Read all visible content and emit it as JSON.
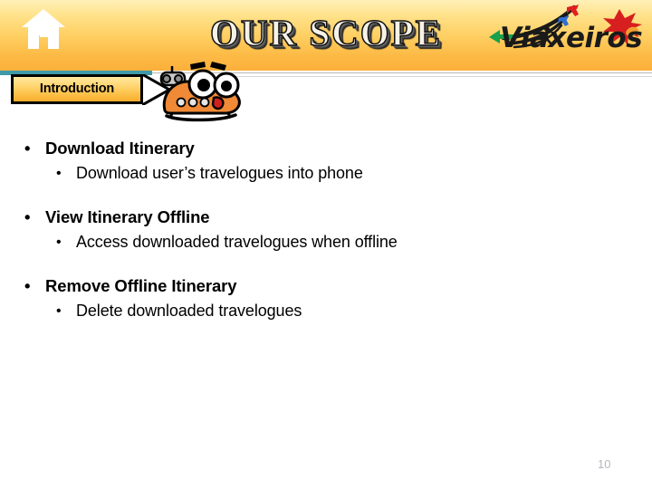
{
  "slide": {
    "title": "OUR SCOPE",
    "page_number": "10",
    "background_color": "#ffffff"
  },
  "header": {
    "home_icon": "home-icon",
    "banner_gradient_top": "#fff0b8",
    "banner_gradient_bottom": "#fbb03b",
    "teal_rule_color": "#3f9aa8",
    "logo": {
      "text": "Viaxeiros",
      "plane_colors": [
        "#18a04a",
        "#2f6fd0",
        "#e02020"
      ],
      "starburst_color": "#d81f1f"
    }
  },
  "tab": {
    "label": "Introduction",
    "mascot_icon": "mascot-vehicle-icon",
    "callout_arrow_icon": "callout-arrow-icon"
  },
  "content": {
    "groups": [
      {
        "heading": "Download Itinerary",
        "bullet": "•",
        "sub": [
          {
            "bullet": "•",
            "text": "Download user’s  travelogues into phone"
          }
        ]
      },
      {
        "heading": "View Itinerary Offline",
        "bullet": "•",
        "sub": [
          {
            "bullet": "•",
            "text": "Access downloaded travelogues when offline"
          }
        ]
      },
      {
        "heading": "Remove Offline Itinerary",
        "bullet": "•",
        "sub": [
          {
            "bullet": "•",
            "text": "Delete downloaded travelogues"
          }
        ]
      }
    ]
  }
}
